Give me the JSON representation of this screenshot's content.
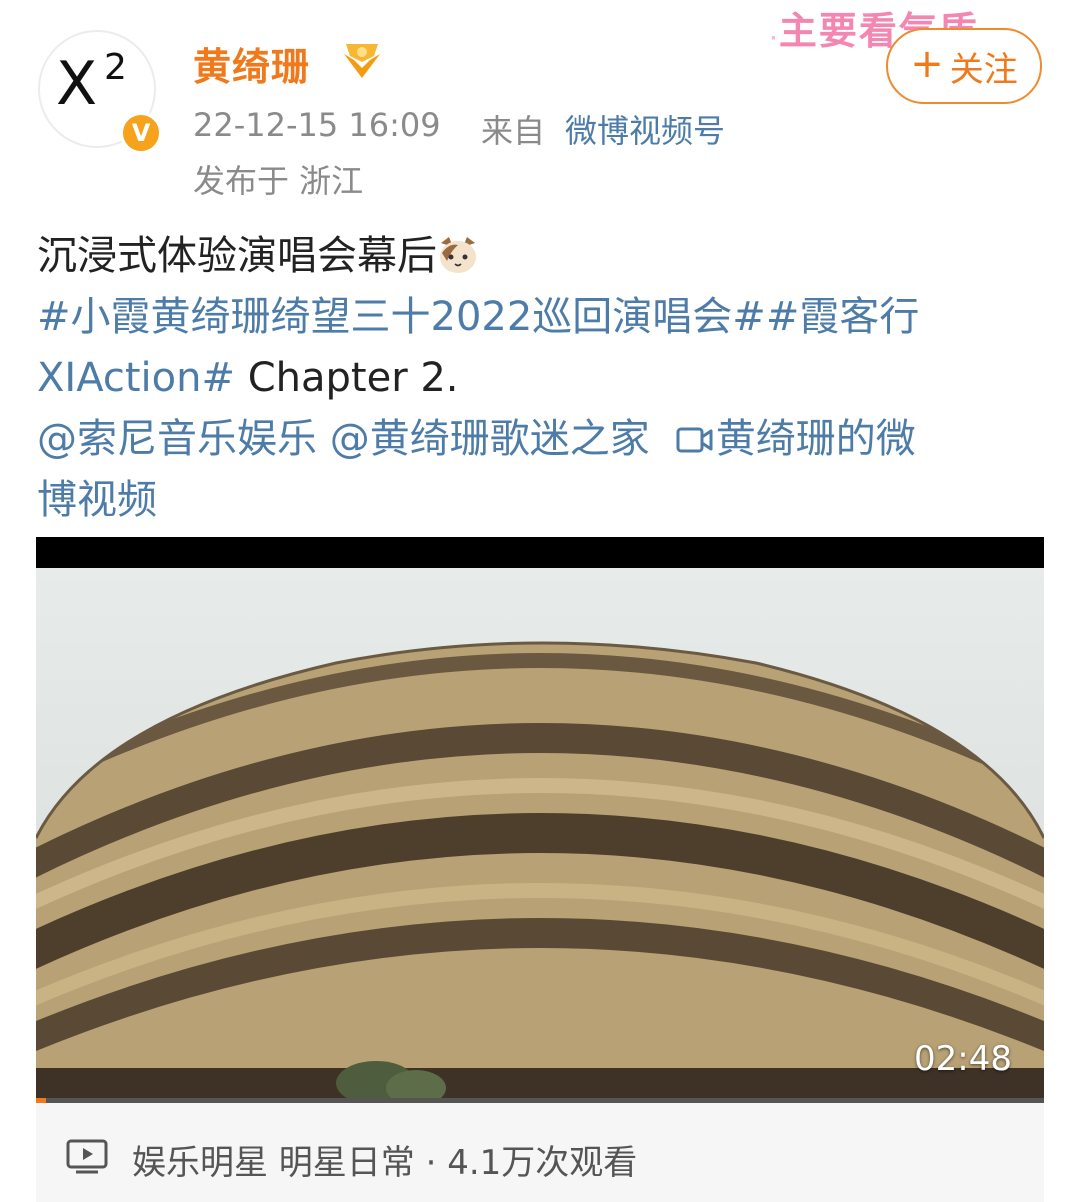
{
  "post": {
    "avatar": {
      "text": "X",
      "sup": "2"
    },
    "verified_mark": "V",
    "username": "黄绮珊",
    "time": "22-12-15 16:09",
    "from_label": "来自",
    "source": "微博视频号",
    "location": "发布于 浙江",
    "sticker_text": "主要看气质",
    "follow_label": "关注",
    "follow_plus": "+",
    "text_line1": "沉浸式体验演唱会幕后",
    "hashtag1": "#小霞黄绮珊绮望三十2022巡回演唱会#",
    "hashtag2_part1": "#霞客行",
    "hashtag2_part2": "XIAction#",
    "text_chapter": " Chapter 2.",
    "mention1": "@索尼音乐娱乐",
    "mention2": "@黄绮珊歌迷之家",
    "video_link_part1": "黄绮珊的微",
    "video_link_part2": "博视频"
  },
  "video": {
    "duration": "02:48",
    "progress_fraction": 0.01
  },
  "info_bar": {
    "tags": "娱乐明星 明星日常 · 4.1万次观看"
  },
  "icons": [
    "verified-icon",
    "medal-badge-icon",
    "cat-emoji-icon",
    "video-camera-icon",
    "play-icon"
  ],
  "colors": {
    "accent": "#f07a1b",
    "link": "#4e7ca8",
    "meta": "#8a8a8a"
  }
}
